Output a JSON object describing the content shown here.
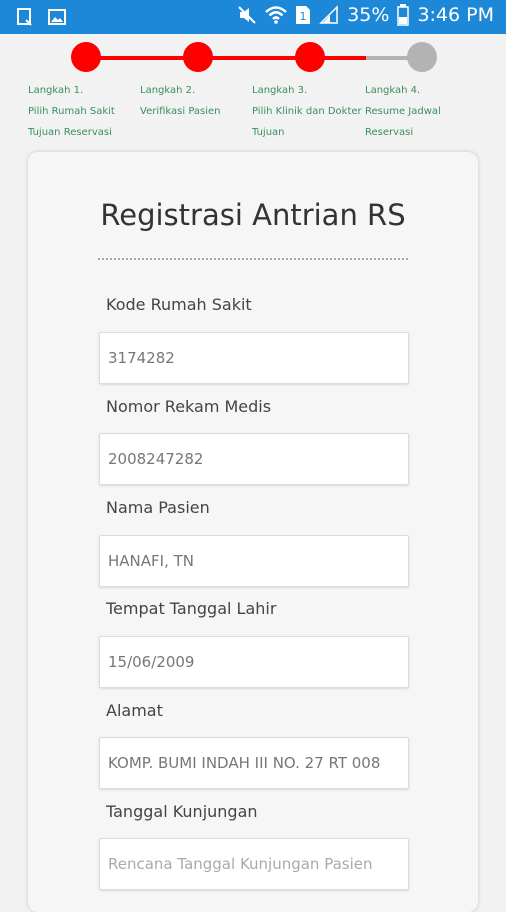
{
  "status_bar": {
    "battery": "35%",
    "time": "3:46 PM",
    "icons": [
      "clipboard-icon",
      "image-icon",
      "mute-icon",
      "wifi-icon",
      "sim-icon",
      "signal-icon",
      "battery-icon"
    ],
    "bg_color": "#1e88d8"
  },
  "stepper": {
    "active_color": "#ff0000",
    "inactive_color": "#b3b3b3",
    "steps": [
      {
        "label": "Langkah 1.\nPilih Rumah Sakit\nTujuan Reservasi",
        "done": true
      },
      {
        "label": "Langkah 2.\nVerifikasi Pasien",
        "done": true
      },
      {
        "label": "Langkah 3.\nPilih Klinik dan Dokter\nTujuan",
        "done": true
      },
      {
        "label": "Langkah 4.\nResume Jadwal\nReservasi",
        "done": false
      }
    ]
  },
  "form": {
    "title": "Registrasi Antrian RS",
    "fields": [
      {
        "label": "Kode Rumah Sakit",
        "value": "3174282",
        "placeholder": ""
      },
      {
        "label": "Nomor Rekam Medis",
        "value": "2008247282",
        "placeholder": ""
      },
      {
        "label": "Nama Pasien",
        "value": "HANAFI, TN",
        "placeholder": ""
      },
      {
        "label": "Tempat Tanggal Lahir",
        "value": "15/06/2009",
        "placeholder": ""
      },
      {
        "label": "Alamat",
        "value": "KOMP. BUMI INDAH III NO. 27 RT 008",
        "placeholder": ""
      },
      {
        "label": "Tanggal Kunjungan",
        "value": "",
        "placeholder": "Rencana Tanggal Kunjungan Pasien"
      }
    ]
  }
}
